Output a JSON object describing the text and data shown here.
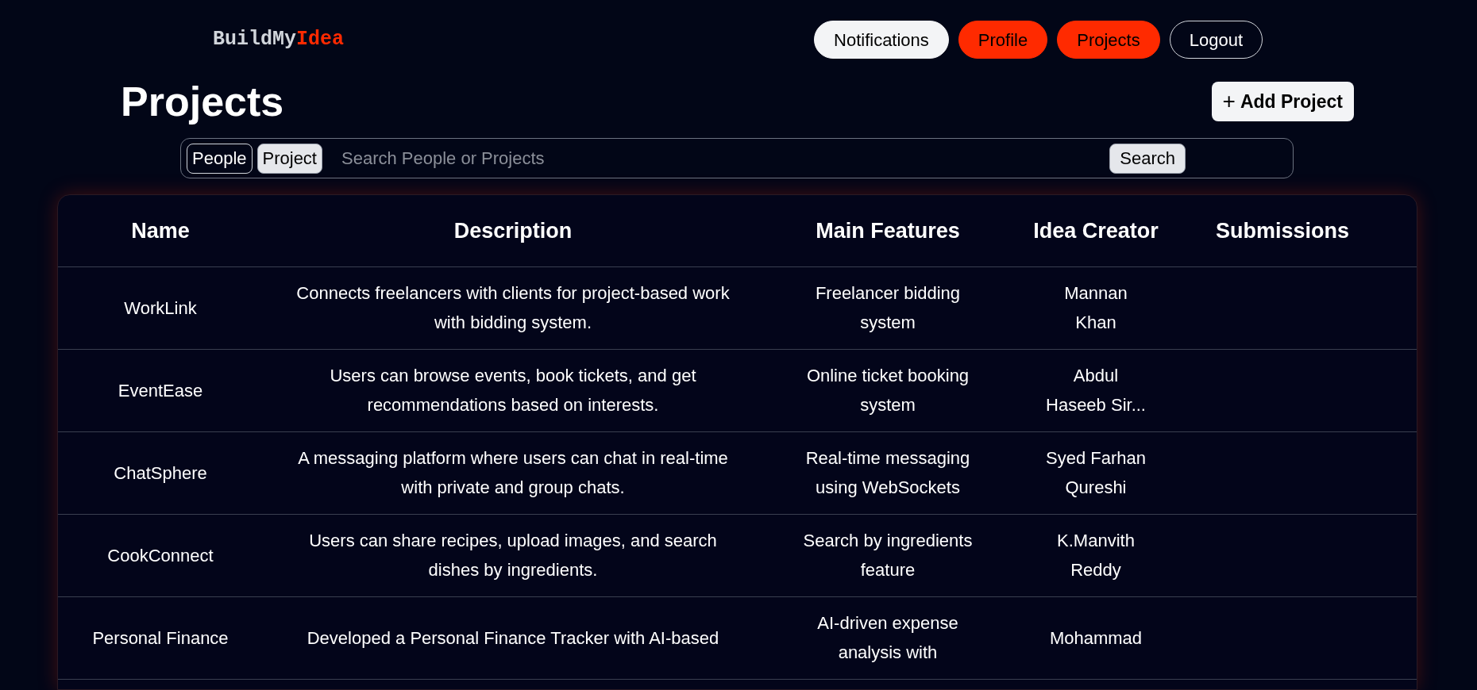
{
  "logo": {
    "first": "BuildMy",
    "second": "Idea"
  },
  "nav": [
    {
      "label": "Notifications",
      "kind": "light"
    },
    {
      "label": "Profile",
      "kind": "accent"
    },
    {
      "label": "Projects",
      "kind": "accent"
    },
    {
      "label": "Logout",
      "kind": "outline"
    }
  ],
  "page_title": "Projects",
  "add_button": {
    "icon": "+",
    "label": "Add Project"
  },
  "search": {
    "toggles": [
      {
        "label": "People",
        "selected": false
      },
      {
        "label": "Project",
        "selected": true
      }
    ],
    "placeholder": "Search People or Projects",
    "button": "Search"
  },
  "table": {
    "columns": [
      "Name",
      "Description",
      "Main Features",
      "Idea Creator",
      "Submissions"
    ],
    "rows": [
      {
        "name": "WorkLink",
        "description": "Connects freelancers with clients for project-based work\nwith bidding system.",
        "features": "Freelancer bidding\nsystem",
        "creator": "Mannan\nKhan"
      },
      {
        "name": "EventEase",
        "description": "Users can browse events, book tickets, and get\nrecommendations based on interests.",
        "features": "Online ticket booking\nsystem",
        "creator": "Abdul\nHaseeb Sir..."
      },
      {
        "name": "ChatSphere",
        "description": "A messaging platform where users can chat in real-time\nwith private and group chats.",
        "features": "Real-time messaging\nusing WebSockets",
        "creator": "Syed Farhan\nQureshi"
      },
      {
        "name": "CookConnect",
        "description": "Users can share recipes, upload images, and search\ndishes by ingredients.",
        "features": "Search by ingredients\nfeature",
        "creator": "K.Manvith\nReddy"
      },
      {
        "name": "Personal Finance",
        "description": "Developed a Personal Finance Tracker with AI-based",
        "features": "AI-driven expense\nanalysis with",
        "creator": "Mohammad"
      }
    ]
  }
}
